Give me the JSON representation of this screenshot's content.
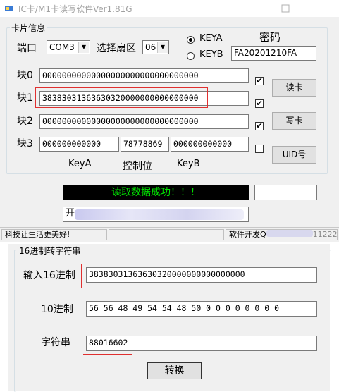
{
  "window": {
    "title": "IC卡/M1卡读写软件Ver1.81G"
  },
  "card_group": {
    "label": "卡片信息",
    "port_label": "端口",
    "port_value": "COM3",
    "sector_label": "选择扇区",
    "sector_value": "06",
    "keya_label": "KEYA",
    "keyb_label": "KEYB",
    "password_label": "密码",
    "password_value": "FA20201210FA",
    "block0_label": "块0",
    "block0_value": "00000000000000000000000000000000",
    "block1_label": "块1",
    "block1_value": "38383031363630320000000000000000",
    "block2_label": "块2",
    "block2_value": "00000000000000000000000000000000",
    "block3_label": "块3",
    "block3_keya": "000000000000",
    "block3_access": "78778869",
    "block3_keyb": "000000000000",
    "keya_caption": "KeyA",
    "access_caption": "控制位",
    "keyb_caption": "KeyB",
    "check_mark": "✔",
    "read_button": "读卡",
    "write_button": "写卡",
    "uid_button": "UID号"
  },
  "status": {
    "message": "读取数据成功！！！",
    "info_prefix": "开",
    "slogan": "科技让生活更美好!",
    "dev_prefix": "软件开发Q",
    "dev_suffix": "11222"
  },
  "converter": {
    "label": "16进制转字符串",
    "hex_label": "输入16进制",
    "hex_value": "38383031363630320000000000000000",
    "dec_label": "10进制",
    "dec_value": "56 56 48 49 54 54 48 50 0 0 0 0 0 0 0 0",
    "str_label": "字符串",
    "str_value": "88016602",
    "convert_button": "转换"
  },
  "colors": {
    "status_bg": "#000000",
    "status_text": "#00e000",
    "highlight": "#e03030"
  },
  "icons": {
    "app": "app-icon",
    "dropdown": "dropdown-arrow-icon"
  }
}
